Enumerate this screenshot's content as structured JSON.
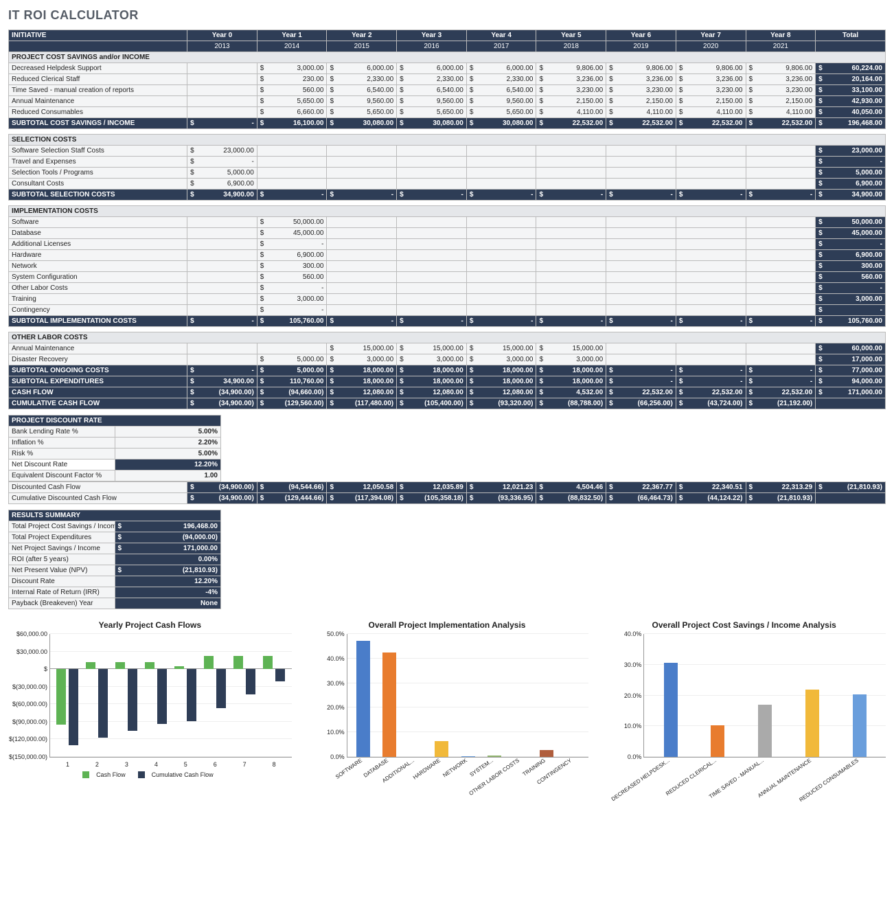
{
  "title": "IT ROI CALCULATOR",
  "columns": {
    "initiative": "INITIATIVE",
    "years": [
      "Year 0",
      "Year 1",
      "Year 2",
      "Year 3",
      "Year 4",
      "Year 5",
      "Year 6",
      "Year 7",
      "Year 8"
    ],
    "year_nums": [
      "2013",
      "2014",
      "2015",
      "2016",
      "2017",
      "2018",
      "2019",
      "2020",
      "2021"
    ],
    "total": "Total"
  },
  "sections": {
    "cost_savings": {
      "header": "PROJECT COST SAVINGS and/or INCOME",
      "rows": [
        {
          "label": "Decreased Helpdesk Support",
          "vals": [
            "",
            "3,000.00",
            "6,000.00",
            "6,000.00",
            "6,000.00",
            "9,806.00",
            "9,806.00",
            "9,806.00",
            "9,806.00"
          ],
          "total": "60,224.00"
        },
        {
          "label": "Reduced Clerical Staff",
          "vals": [
            "",
            "230.00",
            "2,330.00",
            "2,330.00",
            "2,330.00",
            "3,236.00",
            "3,236.00",
            "3,236.00",
            "3,236.00"
          ],
          "total": "20,164.00"
        },
        {
          "label": "Time Saved - manual creation of reports",
          "vals": [
            "",
            "560.00",
            "6,540.00",
            "6,540.00",
            "6,540.00",
            "3,230.00",
            "3,230.00",
            "3,230.00",
            "3,230.00"
          ],
          "total": "33,100.00"
        },
        {
          "label": "Annual Maintenance",
          "vals": [
            "",
            "5,650.00",
            "9,560.00",
            "9,560.00",
            "9,560.00",
            "2,150.00",
            "2,150.00",
            "2,150.00",
            "2,150.00"
          ],
          "total": "42,930.00"
        },
        {
          "label": "Reduced Consumables",
          "vals": [
            "",
            "6,660.00",
            "5,650.00",
            "5,650.00",
            "5,650.00",
            "4,110.00",
            "4,110.00",
            "4,110.00",
            "4,110.00"
          ],
          "total": "40,050.00"
        }
      ],
      "subtotal": {
        "label": "SUBTOTAL COST SAVINGS / INCOME",
        "vals": [
          "-",
          "16,100.00",
          "30,080.00",
          "30,080.00",
          "30,080.00",
          "22,532.00",
          "22,532.00",
          "22,532.00",
          "22,532.00"
        ],
        "total": "196,468.00"
      }
    },
    "selection": {
      "header": "SELECTION COSTS",
      "rows": [
        {
          "label": "Software Selection Staff Costs",
          "vals": [
            "23,000.00",
            "",
            "",
            "",
            "",
            "",
            "",
            "",
            ""
          ],
          "total": "23,000.00"
        },
        {
          "label": "Travel and Expenses",
          "vals": [
            "-",
            "",
            "",
            "",
            "",
            "",
            "",
            "",
            ""
          ],
          "total": "-"
        },
        {
          "label": "Selection Tools / Programs",
          "vals": [
            "5,000.00",
            "",
            "",
            "",
            "",
            "",
            "",
            "",
            ""
          ],
          "total": "5,000.00"
        },
        {
          "label": "Consultant Costs",
          "vals": [
            "6,900.00",
            "",
            "",
            "",
            "",
            "",
            "",
            "",
            ""
          ],
          "total": "6,900.00"
        }
      ],
      "subtotal": {
        "label": "SUBTOTAL SELECTION COSTS",
        "vals": [
          "34,900.00",
          "-",
          "-",
          "-",
          "-",
          "-",
          "-",
          "-",
          "-"
        ],
        "total": "34,900.00"
      }
    },
    "implementation": {
      "header": "IMPLEMENTATION COSTS",
      "rows": [
        {
          "label": "Software",
          "vals": [
            "",
            "50,000.00",
            "",
            "",
            "",
            "",
            "",
            "",
            ""
          ],
          "total": "50,000.00"
        },
        {
          "label": "Database",
          "vals": [
            "",
            "45,000.00",
            "",
            "",
            "",
            "",
            "",
            "",
            ""
          ],
          "total": "45,000.00"
        },
        {
          "label": "Additional Licenses",
          "vals": [
            "",
            "-",
            "",
            "",
            "",
            "",
            "",
            "",
            ""
          ],
          "total": "-"
        },
        {
          "label": "Hardware",
          "vals": [
            "",
            "6,900.00",
            "",
            "",
            "",
            "",
            "",
            "",
            ""
          ],
          "total": "6,900.00"
        },
        {
          "label": "Network",
          "vals": [
            "",
            "300.00",
            "",
            "",
            "",
            "",
            "",
            "",
            ""
          ],
          "total": "300.00"
        },
        {
          "label": "System Configuration",
          "vals": [
            "",
            "560.00",
            "",
            "",
            "",
            "",
            "",
            "",
            ""
          ],
          "total": "560.00"
        },
        {
          "label": "Other Labor Costs",
          "vals": [
            "",
            "-",
            "",
            "",
            "",
            "",
            "",
            "",
            ""
          ],
          "total": "-"
        },
        {
          "label": "Training",
          "vals": [
            "",
            "3,000.00",
            "",
            "",
            "",
            "",
            "",
            "",
            ""
          ],
          "total": "3,000.00"
        },
        {
          "label": "Contingency",
          "vals": [
            "",
            "-",
            "",
            "",
            "",
            "",
            "",
            "",
            ""
          ],
          "total": "-"
        }
      ],
      "subtotal": {
        "label": "SUBTOTAL IMPLEMENTATION COSTS",
        "vals": [
          "-",
          "105,760.00",
          "-",
          "-",
          "-",
          "-",
          "-",
          "-",
          "-"
        ],
        "total": "105,760.00"
      }
    },
    "other_labor": {
      "header": "OTHER LABOR COSTS",
      "rows": [
        {
          "label": "Annual Maintenance",
          "vals": [
            "",
            "",
            "15,000.00",
            "15,000.00",
            "15,000.00",
            "15,000.00",
            "",
            "",
            ""
          ],
          "total": "60,000.00"
        },
        {
          "label": "Disaster Recovery",
          "vals": [
            "",
            "5,000.00",
            "3,000.00",
            "3,000.00",
            "3,000.00",
            "3,000.00",
            "",
            "",
            ""
          ],
          "total": "17,000.00"
        }
      ],
      "subtotals": [
        {
          "label": "SUBTOTAL ONGOING COSTS",
          "vals": [
            "-",
            "5,000.00",
            "18,000.00",
            "18,000.00",
            "18,000.00",
            "18,000.00",
            "-",
            "-",
            "-"
          ],
          "total": "77,000.00"
        },
        {
          "label": "SUBTOTAL EXPENDITURES",
          "vals": [
            "34,900.00",
            "110,760.00",
            "18,000.00",
            "18,000.00",
            "18,000.00",
            "18,000.00",
            "-",
            "-",
            "-"
          ],
          "total": "94,000.00"
        },
        {
          "label": "CASH FLOW",
          "vals": [
            "(34,900.00)",
            "(94,660.00)",
            "12,080.00",
            "12,080.00",
            "12,080.00",
            "4,532.00",
            "22,532.00",
            "22,532.00",
            "22,532.00"
          ],
          "total": "171,000.00"
        },
        {
          "label": "CUMULATIVE CASH FLOW",
          "vals": [
            "(34,900.00)",
            "(129,560.00)",
            "(117,480.00)",
            "(105,400.00)",
            "(93,320.00)",
            "(88,788.00)",
            "(66,256.00)",
            "(43,724.00)",
            "(21,192.00)"
          ],
          "total": ""
        }
      ]
    }
  },
  "discount": {
    "header": "PROJECT DISCOUNT RATE",
    "rows": [
      {
        "label": "Bank Lending Rate %",
        "val": "5.00%"
      },
      {
        "label": "Inflation %",
        "val": "2.20%"
      },
      {
        "label": "Risk %",
        "val": "5.00%"
      },
      {
        "label": "Net Discount Rate",
        "val": "12.20%",
        "dark": true
      },
      {
        "label": "Equivalent Discount Factor %",
        "val": "1.00"
      }
    ],
    "dcf": {
      "label": "Discounted Cash Flow",
      "vals": [
        "(34,900.00)",
        "(94,544.66)",
        "12,050.58",
        "12,035.89",
        "12,021.23",
        "4,504.46",
        "22,367.77",
        "22,340.51",
        "22,313.29"
      ],
      "total": "(21,810.93)"
    },
    "cdcf": {
      "label": "Cumulative Discounted Cash Flow",
      "vals": [
        "(34,900.00)",
        "(129,444.66)",
        "(117,394.08)",
        "(105,358.18)",
        "(93,336.95)",
        "(88,832.50)",
        "(66,464.73)",
        "(44,124.22)",
        "(21,810.93)"
      ],
      "total": ""
    }
  },
  "results": {
    "header": "RESULTS SUMMARY",
    "rows": [
      {
        "label": "Total Project Cost Savings / Income",
        "val": "196,468.00",
        "dollar": true
      },
      {
        "label": "Total Project Expenditures",
        "val": "(94,000.00)",
        "dollar": true
      },
      {
        "label": "Net Project Savings / Income",
        "val": "171,000.00",
        "dollar": true
      },
      {
        "label": "ROI (after 5 years)",
        "val": "0.00%"
      },
      {
        "label": "Net Present Value (NPV)",
        "val": "(21,810.93)",
        "dollar": true
      },
      {
        "label": "Discount Rate",
        "val": "12.20%"
      },
      {
        "label": "Internal Rate of Return (IRR)",
        "val": "-4%"
      },
      {
        "label": "Payback (Breakeven) Year",
        "val": "None"
      }
    ]
  },
  "chart_data": [
    {
      "type": "bar",
      "title": "Yearly Project Cash Flows",
      "x": [
        "1",
        "2",
        "3",
        "4",
        "5",
        "6",
        "7",
        "8"
      ],
      "series": [
        {
          "name": "Cash Flow",
          "values": [
            -94660,
            12080,
            12080,
            12080,
            4532,
            22532,
            22532,
            22532
          ],
          "color": "#5eb354"
        },
        {
          "name": "Cumulative Cash Flow",
          "values": [
            -129560,
            -117480,
            -105400,
            -93320,
            -88788,
            -66256,
            -43724,
            -21192
          ],
          "color": "#2e3d56"
        }
      ],
      "ylim": [
        -150000,
        60000
      ],
      "yticks_labels": [
        "$(150,000.00)",
        "$(120,000.00)",
        "$(90,000.00)",
        "$(60,000.00)",
        "$(30,000.00)",
        "$",
        "$30,000.00",
        "$60,000.00"
      ],
      "yticks": [
        -150000,
        -120000,
        -90000,
        -60000,
        -30000,
        0,
        30000,
        60000
      ]
    },
    {
      "type": "bar",
      "title": "Overall Project Implementation Analysis",
      "categories": [
        "SOFTWARE",
        "DATABASE",
        "ADDITIONAL...",
        "HARDWARE",
        "NETWORK",
        "SYSTEM...",
        "OTHER LABOR COSTS",
        "TRAINING",
        "CONTINGENCY"
      ],
      "values_pct": [
        47.3,
        42.5,
        0.0,
        6.5,
        0.3,
        0.5,
        0.0,
        2.8,
        0.0
      ],
      "ylim": [
        0,
        50
      ],
      "yticks_labels": [
        "0.0%",
        "10.0%",
        "20.0%",
        "30.0%",
        "40.0%",
        "50.0%"
      ],
      "yticks": [
        0,
        10,
        20,
        30,
        40,
        50
      ],
      "colors": [
        "#4a7dc9",
        "#e87c2e",
        "#aaa",
        "#f1b93a",
        "#6a9edc",
        "#8fb36d",
        "#3a5fa5",
        "#b05e3d",
        "#707070"
      ]
    },
    {
      "type": "bar",
      "title": "Overall Project Cost Savings / Income Analysis",
      "categories": [
        "DECREASED HELPDESK...",
        "REDUCED CLERICAL...",
        "TIME SAVED - MANUAL...",
        "ANNUAL MAINTENANCE",
        "REDUCED CONSUMABLES"
      ],
      "values_pct": [
        30.7,
        10.3,
        16.9,
        21.9,
        20.4
      ],
      "ylim": [
        0,
        40
      ],
      "yticks_labels": [
        "0.0%",
        "10.0%",
        "20.0%",
        "30.0%",
        "40.0%"
      ],
      "yticks": [
        0,
        10,
        20,
        30,
        40
      ],
      "colors": [
        "#4a7dc9",
        "#e87c2e",
        "#aaa",
        "#f1b93a",
        "#6a9edc"
      ]
    }
  ],
  "legend": {
    "cf": "Cash Flow",
    "ccf": "Cumulative Cash Flow"
  }
}
